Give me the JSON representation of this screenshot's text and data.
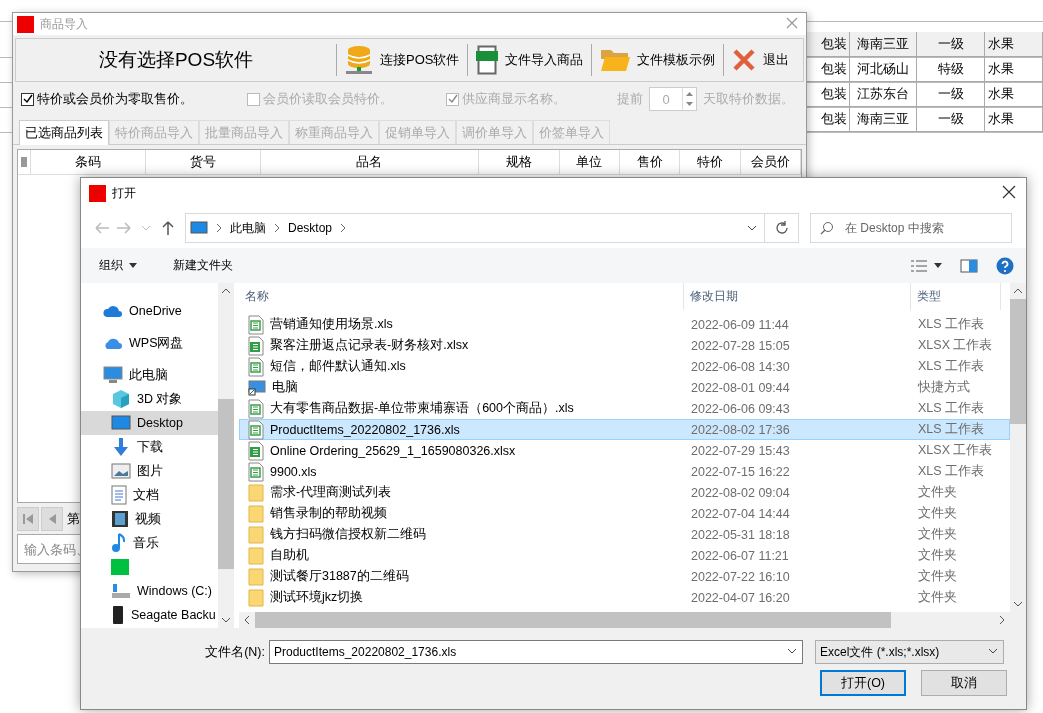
{
  "background_sheet": {
    "rows": [
      {
        "cells": [
          "包装",
          "海南三亚",
          "一级",
          "水果"
        ],
        "highlighted": true
      },
      {
        "cells": [
          "包装",
          "河北砀山",
          "特级",
          "水果"
        ],
        "highlighted": false
      },
      {
        "cells": [
          "包装",
          "江苏东台",
          "一级",
          "水果"
        ],
        "highlighted": false
      },
      {
        "cells": [
          "包装",
          "海南三亚",
          "一级",
          "水果"
        ],
        "highlighted": false
      }
    ]
  },
  "import_window": {
    "title": "商品导入",
    "pos_label": "没有选择POS软件",
    "toolbar": [
      {
        "kind": "database",
        "label": "连接POS软件"
      },
      {
        "kind": "xls",
        "label": "文件导入商品"
      },
      {
        "kind": "folder",
        "label": "文件模板示例"
      },
      {
        "kind": "exit",
        "label": "退出"
      }
    ],
    "options": [
      {
        "label": "特价或会员价为零取售价。",
        "checked": true,
        "disabled": false
      },
      {
        "label": "会员价读取会员特价。",
        "checked": false,
        "disabled": true
      },
      {
        "label": "供应商显示名称。",
        "checked": true,
        "disabled": true
      }
    ],
    "days_before": {
      "label": "提前",
      "value": "0",
      "suffix": "天取特价数据。",
      "disabled": true
    },
    "tabs": [
      {
        "label": "已选商品列表",
        "selected": true,
        "disabled": false
      },
      {
        "label": "特价商品导入",
        "selected": false,
        "disabled": true
      },
      {
        "label": "批量商品导入",
        "selected": false,
        "disabled": true
      },
      {
        "label": "称重商品导入",
        "selected": false,
        "disabled": true
      },
      {
        "label": "促销单导入",
        "selected": false,
        "disabled": true
      },
      {
        "label": "调价单导入",
        "selected": false,
        "disabled": true
      },
      {
        "label": "价签单导入",
        "selected": false,
        "disabled": true
      }
    ],
    "table": {
      "columns": [
        "条码",
        "货号",
        "品名",
        "规格",
        "单位",
        "售价",
        "特价",
        "会员价"
      ]
    },
    "pager_label": "第",
    "search": {
      "placeholder": "输入条码、"
    }
  },
  "open_dialog": {
    "title": "打开",
    "address": {
      "path": [
        "此电脑",
        "Desktop"
      ]
    },
    "search": {
      "placeholder": "在 Desktop 中搜索"
    },
    "commands": [
      {
        "label": "组织",
        "dropdown": true
      },
      {
        "label": "新建文件夹",
        "dropdown": false
      }
    ],
    "nav": [
      {
        "kind": "onedrive",
        "label": "OneDrive",
        "selected": false
      },
      {
        "kind": "wps",
        "label": "WPS网盘",
        "selected": false
      },
      {
        "kind": "pc",
        "label": "此电脑",
        "selected": false,
        "children": [
          {
            "kind": "cube",
            "label": "3D 对象",
            "selected": false
          },
          {
            "kind": "desktop",
            "label": "Desktop",
            "selected": true
          },
          {
            "kind": "download",
            "label": "下载",
            "selected": false
          },
          {
            "kind": "pictures",
            "label": "图片",
            "selected": false
          },
          {
            "kind": "docs",
            "label": "文档",
            "selected": false
          },
          {
            "kind": "video",
            "label": "视频",
            "selected": false
          },
          {
            "kind": "music",
            "label": "音乐",
            "selected": false
          },
          {
            "kind": "iqiyi",
            "selected": false
          },
          {
            "kind": "drive",
            "label": "Windows (C:)",
            "selected": false
          },
          {
            "kind": "usb",
            "label": "Seagate Backu",
            "selected": false
          }
        ]
      }
    ],
    "columns": [
      "名称",
      "修改日期",
      "类型"
    ],
    "files": [
      {
        "kind": "xls",
        "name": "营销通知使用场景.xls",
        "date": "2022-06-09 11:44",
        "type": "XLS 工作表",
        "selected": false
      },
      {
        "kind": "xlsx",
        "name": "聚客注册返点记录表-财务核对.xlsx",
        "date": "2022-07-28 15:05",
        "type": "XLSX 工作表",
        "selected": false
      },
      {
        "kind": "xls",
        "name": "短信，邮件默认通知.xls",
        "date": "2022-06-08 14:30",
        "type": "XLS 工作表",
        "selected": false
      },
      {
        "kind": "shortcut",
        "name": "电脑",
        "date": "2022-08-01 09:44",
        "type": "快捷方式",
        "selected": false
      },
      {
        "kind": "xls",
        "name": "大有零售商品数据-单位带柬埔寨语（600个商品）.xls",
        "date": "2022-06-06 09:43",
        "type": "XLS 工作表",
        "selected": false
      },
      {
        "kind": "xls",
        "name": "ProductItems_20220802_1736.xls",
        "date": "2022-08-02 17:36",
        "type": "XLS 工作表",
        "selected": true
      },
      {
        "kind": "xlsx",
        "name": "Online Ordering_25629_1_1659080326.xlsx",
        "date": "2022-07-29 15:43",
        "type": "XLSX 工作表",
        "selected": false
      },
      {
        "kind": "xls",
        "name": "9900.xls",
        "date": "2022-07-15 16:22",
        "type": "XLS 工作表",
        "selected": false
      },
      {
        "kind": "folder",
        "name": "需求-代理商测试列表",
        "date": "2022-08-02 09:04",
        "type": "文件夹",
        "selected": false
      },
      {
        "kind": "folder",
        "name": "销售录制的帮助视频",
        "date": "2022-07-04 14:44",
        "type": "文件夹",
        "selected": false
      },
      {
        "kind": "folder",
        "name": "钱方扫码微信授权新二维码",
        "date": "2022-05-31 18:18",
        "type": "文件夹",
        "selected": false
      },
      {
        "kind": "folder",
        "name": "自助机",
        "date": "2022-06-07 11:21",
        "type": "文件夹",
        "selected": false
      },
      {
        "kind": "folder",
        "name": "测试餐厅31887的二维码",
        "date": "2022-07-22 16:10",
        "type": "文件夹",
        "selected": false
      },
      {
        "kind": "folder",
        "name": "测试环境jkz切换",
        "date": "2022-04-07 16:20",
        "type": "文件夹",
        "selected": false
      }
    ],
    "file_name": {
      "label": "文件名(N):",
      "value": "ProductItems_20220802_1736.xls"
    },
    "file_type": {
      "value": "Excel文件 (*.xls;*.xlsx)"
    },
    "buttons": [
      {
        "label": "打开(O)",
        "default": true
      },
      {
        "label": "取消",
        "default": false
      }
    ]
  }
}
